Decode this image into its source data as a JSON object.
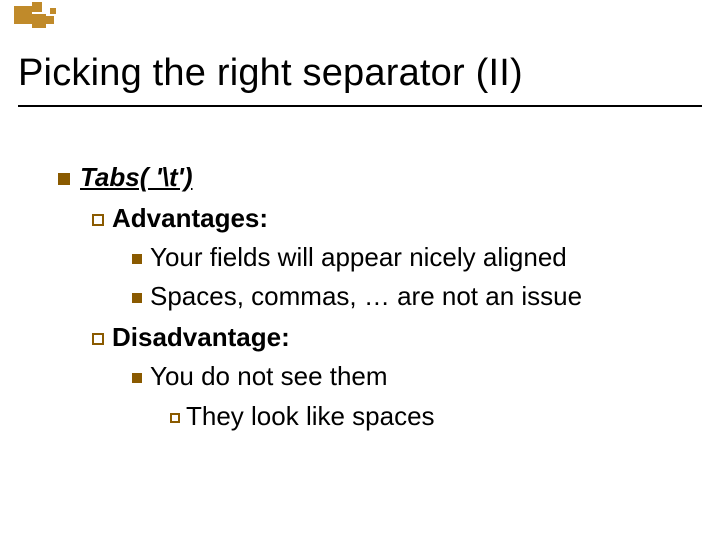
{
  "title": "Picking the right separator (II)",
  "lvl1": {
    "label": "Tabs( '\\t')"
  },
  "lvl2a": {
    "label": "Advantages:"
  },
  "lvl3a": {
    "text": "Your fields will appear nicely aligned"
  },
  "lvl3b": {
    "text": "Spaces, commas, … are not an issue"
  },
  "lvl2b": {
    "label": "Disadvantage:"
  },
  "lvl3c": {
    "text": "You do not see them"
  },
  "lvl4a": {
    "text": "They look like spaces"
  }
}
